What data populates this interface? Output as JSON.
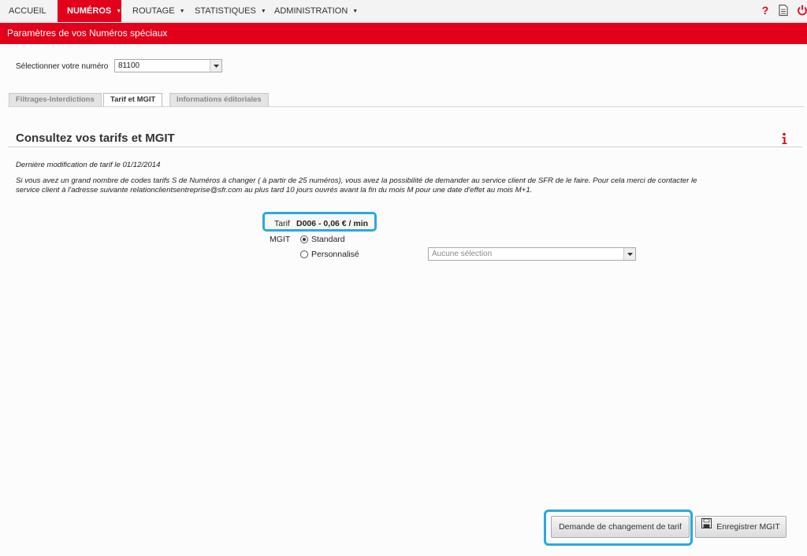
{
  "nav": {
    "items": [
      {
        "label": "Accueil",
        "caret": false
      },
      {
        "label": "Numéros",
        "caret": true,
        "active": true
      },
      {
        "label": "Routage",
        "caret": true
      },
      {
        "label": "Statistiques",
        "caret": true
      },
      {
        "label": "Administration",
        "caret": true
      }
    ],
    "icons": [
      "help-icon",
      "document-icon",
      "power-icon"
    ]
  },
  "title_bar": "Paramètres de vos Numéros spéciaux",
  "number_select": {
    "label": "Sélectionner votre numéro",
    "value": "81100"
  },
  "tabs": [
    {
      "label": "Filtrages-Interdictions",
      "active": false
    },
    {
      "label": "Tarif et MGIT",
      "active": true
    },
    {
      "label": "Informations éditoriales",
      "active": false
    }
  ],
  "section": {
    "heading": "Consultez vos tarifs et MGIT",
    "last_modified": "Dernière modification de tarif le 01/12/2014",
    "info_line1": "Si vous avez un grand nombre de codes tarifs S de Numéros à changer ( à partir de 25 numéros), vous avez la possibilité de demander au service client de SFR de le faire. Pour cela merci de contacter le",
    "info_line2": "service client à l'adresse suivante relationclientsentreprise@sfr.com au plus tard 10 jours ouvrés avant la fin du mois M pour une date d'effet au mois M+1."
  },
  "tarif": {
    "label": "Tarif",
    "value": "D006 - 0,06 € / min"
  },
  "mgit": {
    "label": "MGIT",
    "options": [
      {
        "label": "Standard",
        "checked": true
      },
      {
        "label": "Personnalisé",
        "checked": false
      }
    ],
    "custom_select_placeholder": "Aucune sélection"
  },
  "buttons": {
    "change_tarif": "Demande de changement de tarif",
    "save_mgit": "Enregistrer MGIT"
  },
  "colors": {
    "brand_red": "#e2001a",
    "highlight_blue": "#29a9e1"
  }
}
